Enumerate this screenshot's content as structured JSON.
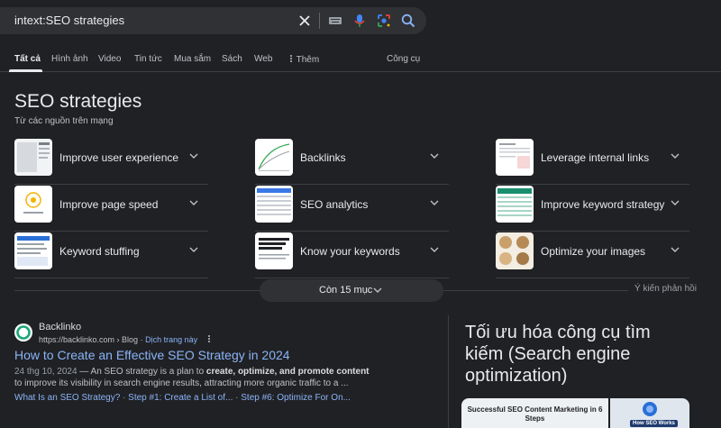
{
  "search": {
    "query": "intext:SEO strategies",
    "icons": [
      "close-icon",
      "keyboard-icon",
      "microphone-icon",
      "lens-icon",
      "search-icon"
    ]
  },
  "tabs": [
    {
      "label": "Tất cả",
      "active": true
    },
    {
      "label": "Hình ảnh"
    },
    {
      "label": "Video"
    },
    {
      "label": "Tin tức"
    },
    {
      "label": "Mua sắm"
    },
    {
      "label": "Sách"
    },
    {
      "label": "Web"
    },
    {
      "label": "Thêm"
    },
    {
      "label": "Công cụ"
    }
  ],
  "seo_block": {
    "title": "SEO strategies",
    "subtitle": "Từ các nguồn trên mạng",
    "items": [
      {
        "label": "Improve user experience"
      },
      {
        "label": "Backlinks"
      },
      {
        "label": "Leverage internal links"
      },
      {
        "label": "Improve page speed"
      },
      {
        "label": "SEO analytics"
      },
      {
        "label": "Improve keyword strategy"
      },
      {
        "label": "Keyword stuffing"
      },
      {
        "label": "Know your keywords"
      },
      {
        "label": "Optimize your images"
      }
    ],
    "more_label": "Còn 15 mục",
    "feedback": "Ý kiến phản hồi"
  },
  "result": {
    "site_name": "Backlinko",
    "url": "https://backlinko.com › Blog",
    "translate": "Dịch trang này",
    "title": "How to Create an Effective SEO Strategy in 2024",
    "date": "24 thg 10, 2024",
    "snippet_a": " — An SEO strategy is a plan to ",
    "snippet_b": "create, optimize, and promote content",
    "snippet_c": " to improve its visibility in search engine results, attracting more organic traffic to a ...",
    "sitelinks": [
      "What Is an SEO Strategy?",
      "Step #1: Create a List of...",
      "Step #6: Optimize For On..."
    ]
  },
  "knowledge_panel": {
    "title": "Tối ưu hóa công cụ tìm kiếm (Search engine optimization)",
    "image1_caption": "Successful SEO Content Marketing in 6 Steps",
    "image2_caption": "How SEO Works"
  },
  "colors": {
    "background": "#202124",
    "link": "#8ab4f8",
    "text": "#e8eaed"
  }
}
